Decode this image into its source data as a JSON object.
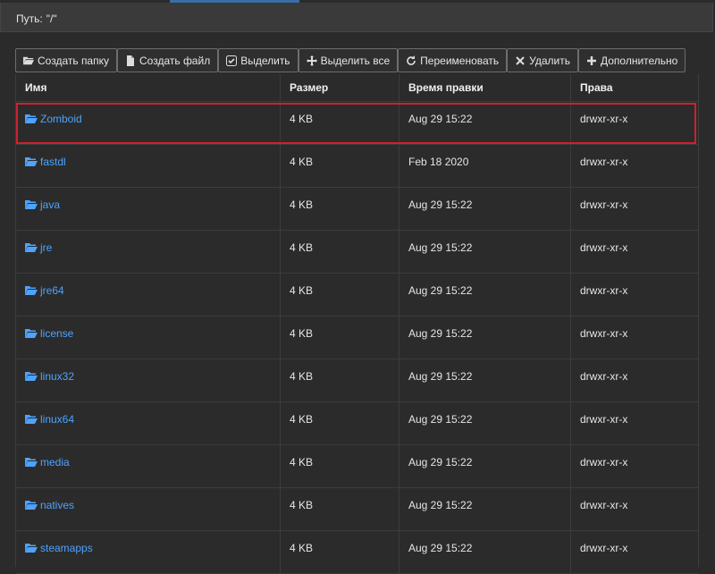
{
  "path": {
    "label": "Путь:",
    "value": "\"/\""
  },
  "toolbar": [
    {
      "label": "Создать папку",
      "icon": "folder-open-icon"
    },
    {
      "label": "Создать файл",
      "icon": "file-icon"
    },
    {
      "label": "Выделить",
      "icon": "check-square-icon"
    },
    {
      "label": "Выделить все",
      "icon": "move-icon"
    },
    {
      "label": "Переименовать",
      "icon": "refresh-icon"
    },
    {
      "label": "Удалить",
      "icon": "close-icon"
    },
    {
      "label": "Дополнительно",
      "icon": "plus-icon"
    }
  ],
  "table": {
    "headers": [
      "Имя",
      "Размер",
      "Время правки",
      "Права"
    ],
    "rows": [
      {
        "name": "Zomboid",
        "size": "4 KB",
        "modified": "Aug 29 15:22",
        "perms": "drwxr-xr-x"
      },
      {
        "name": "fastdl",
        "size": "4 KB",
        "modified": "Feb 18 2020",
        "perms": "drwxr-xr-x"
      },
      {
        "name": "java",
        "size": "4 KB",
        "modified": "Aug 29 15:22",
        "perms": "drwxr-xr-x"
      },
      {
        "name": "jre",
        "size": "4 KB",
        "modified": "Aug 29 15:22",
        "perms": "drwxr-xr-x"
      },
      {
        "name": "jre64",
        "size": "4 KB",
        "modified": "Aug 29 15:22",
        "perms": "drwxr-xr-x"
      },
      {
        "name": "license",
        "size": "4 KB",
        "modified": "Aug 29 15:22",
        "perms": "drwxr-xr-x"
      },
      {
        "name": "linux32",
        "size": "4 KB",
        "modified": "Aug 29 15:22",
        "perms": "drwxr-xr-x"
      },
      {
        "name": "linux64",
        "size": "4 KB",
        "modified": "Aug 29 15:22",
        "perms": "drwxr-xr-x"
      },
      {
        "name": "media",
        "size": "4 KB",
        "modified": "Aug 29 15:22",
        "perms": "drwxr-xr-x"
      },
      {
        "name": "natives",
        "size": "4 KB",
        "modified": "Aug 29 15:22",
        "perms": "drwxr-xr-x"
      },
      {
        "name": "steamapps",
        "size": "4 KB",
        "modified": "Aug 29 15:22",
        "perms": "drwxr-xr-x"
      }
    ]
  },
  "colors": {
    "link": "#4da3ff",
    "highlight": "#d0202c",
    "background": "#2b2b2b"
  }
}
